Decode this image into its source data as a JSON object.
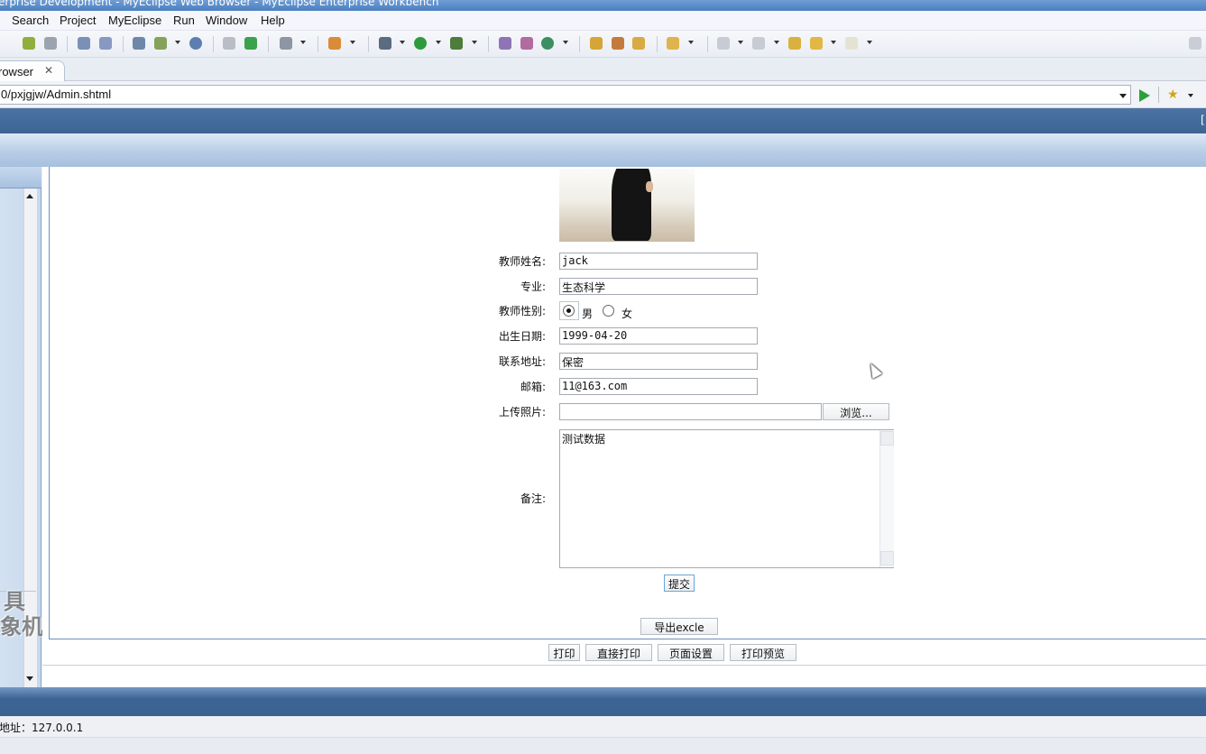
{
  "window": {
    "title": "erprise Development - MyEclipse Web Browser - MyEclipse Enterprise Workbench"
  },
  "menu": {
    "items": [
      "Search",
      "Project",
      "MyEclipse",
      "Run",
      "Window",
      "Help"
    ]
  },
  "tab": {
    "label": "rowser",
    "close": "✕"
  },
  "address": {
    "url": "0/pxjgjw/Admin.shtml"
  },
  "form": {
    "name_label": "教师姓名:",
    "name_value": "jack",
    "major_label": "专业:",
    "major_value": "生态科学",
    "gender_label": "教师性别:",
    "gender_male": "男",
    "gender_female": "女",
    "gender_selected": "男",
    "birth_label": "出生日期:",
    "birth_value": "1999-04-20",
    "address_label": "联系地址:",
    "address_value": "保密",
    "email_label": "邮箱:",
    "email_value": "11@163.com",
    "photo_label": "上传照片:",
    "photo_value": "",
    "browse_button": "浏览...",
    "remark_label": "备注:",
    "remark_value": "测试数据",
    "submit_button": "提交",
    "export_button": "导出excle"
  },
  "print_buttons": {
    "print": "打印",
    "direct_print": "直接打印",
    "page_setup": "页面设置",
    "print_preview": "打印预览"
  },
  "status": {
    "text": "地址：127.0.0.1"
  },
  "watermark": {
    "line1": "具",
    "line2": "象机"
  }
}
